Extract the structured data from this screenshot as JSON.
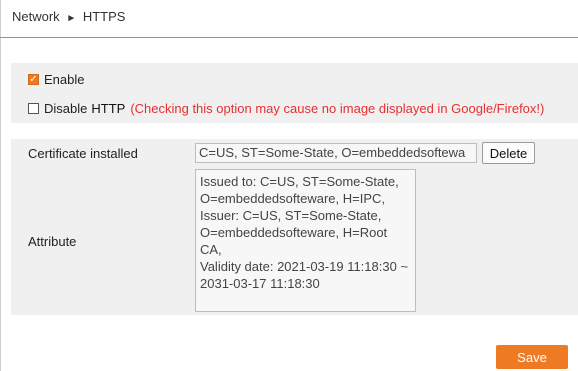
{
  "breadcrumb": {
    "section": "Network",
    "separator": "►",
    "page": "HTTPS"
  },
  "enable": {
    "label": "Enable",
    "checked": true
  },
  "disable_http": {
    "label": "Disable",
    "protocol": "HTTP",
    "warning": "(Checking this option may cause no image displayed in Google/Firefox!)",
    "checked": false
  },
  "certificate": {
    "label": "Certificate installed",
    "value": "C=US, ST=Some-State, O=embeddedsoftewa",
    "delete_label": "Delete"
  },
  "attribute": {
    "label": "Attribute",
    "lines": [
      "Issued to: C=US, ST=Some-State,",
      "O=embeddedsofteware, H=IPC,",
      "Issuer: C=US, ST=Some-State,",
      "O=embeddedsofteware, H=Root CA,",
      "Validity date: 2021-03-19 11:18:30 ~",
      "2031-03-17 11:18:30"
    ]
  },
  "save_label": "Save",
  "colors": {
    "accent": "#ee7a24",
    "warning": "#e53030",
    "panel": "#f0f0f0"
  }
}
